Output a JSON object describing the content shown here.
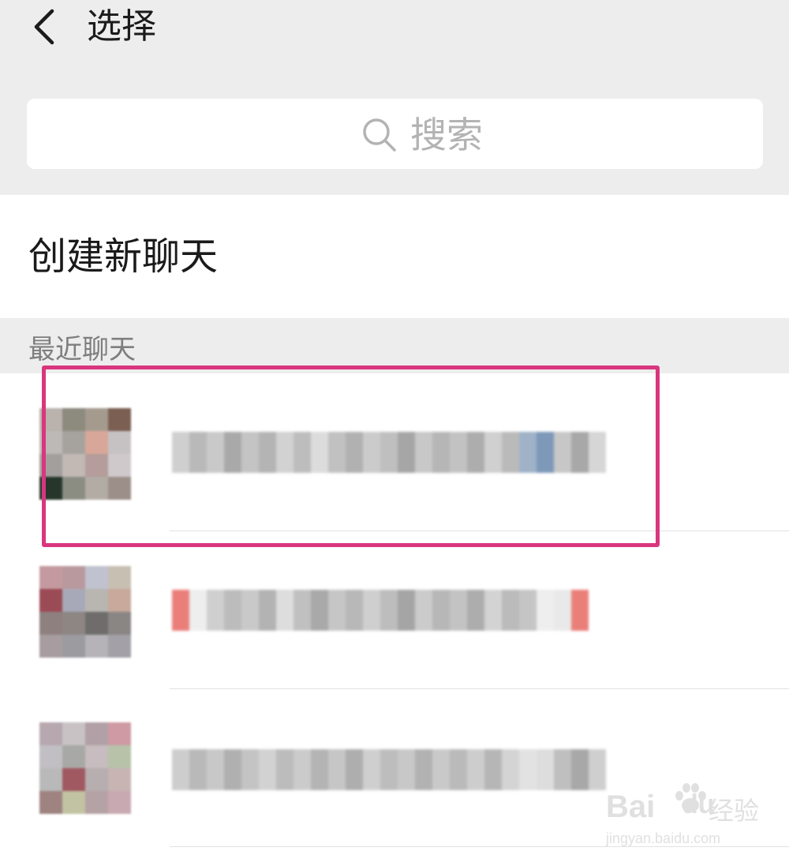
{
  "header": {
    "title": "选择",
    "back_icon": "chevron-left-icon"
  },
  "search": {
    "placeholder": "搜索",
    "icon": "search-icon"
  },
  "new_chat": {
    "label": "创建新聊天"
  },
  "recent": {
    "section_label": "最近聊天",
    "highlight_color": "#d9367d"
  },
  "watermark": {
    "brand": "Bai",
    "brand_suffix": "du",
    "cn": "经验",
    "url": "jingyan.baidu.com"
  }
}
